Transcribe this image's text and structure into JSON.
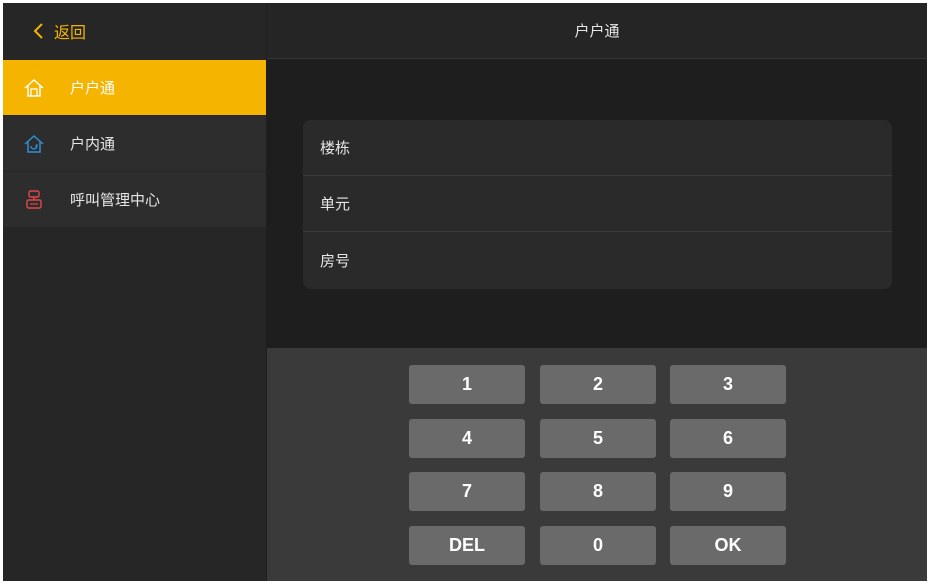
{
  "sidebar": {
    "back_label": "返回",
    "items": [
      {
        "label": "户户通",
        "icon": "house-icon",
        "active": true
      },
      {
        "label": "户内通",
        "icon": "indoor-house-icon",
        "active": false
      },
      {
        "label": "呼叫管理中心",
        "icon": "call-center-icon",
        "active": false
      }
    ]
  },
  "header": {
    "title": "户户通"
  },
  "form": {
    "building_label": "楼栋",
    "unit_label": "单元",
    "room_label": "房号"
  },
  "keypad": {
    "keys": [
      "1",
      "2",
      "3",
      "4",
      "5",
      "6",
      "7",
      "8",
      "9",
      "DEL",
      "0",
      "OK"
    ]
  },
  "colors": {
    "accent": "#f5b400",
    "indoor_icon": "#2f8fd6",
    "call_icon": "#e04848",
    "key_bg": "#6a6a6a",
    "keypad_bg": "#3a3a3a"
  }
}
